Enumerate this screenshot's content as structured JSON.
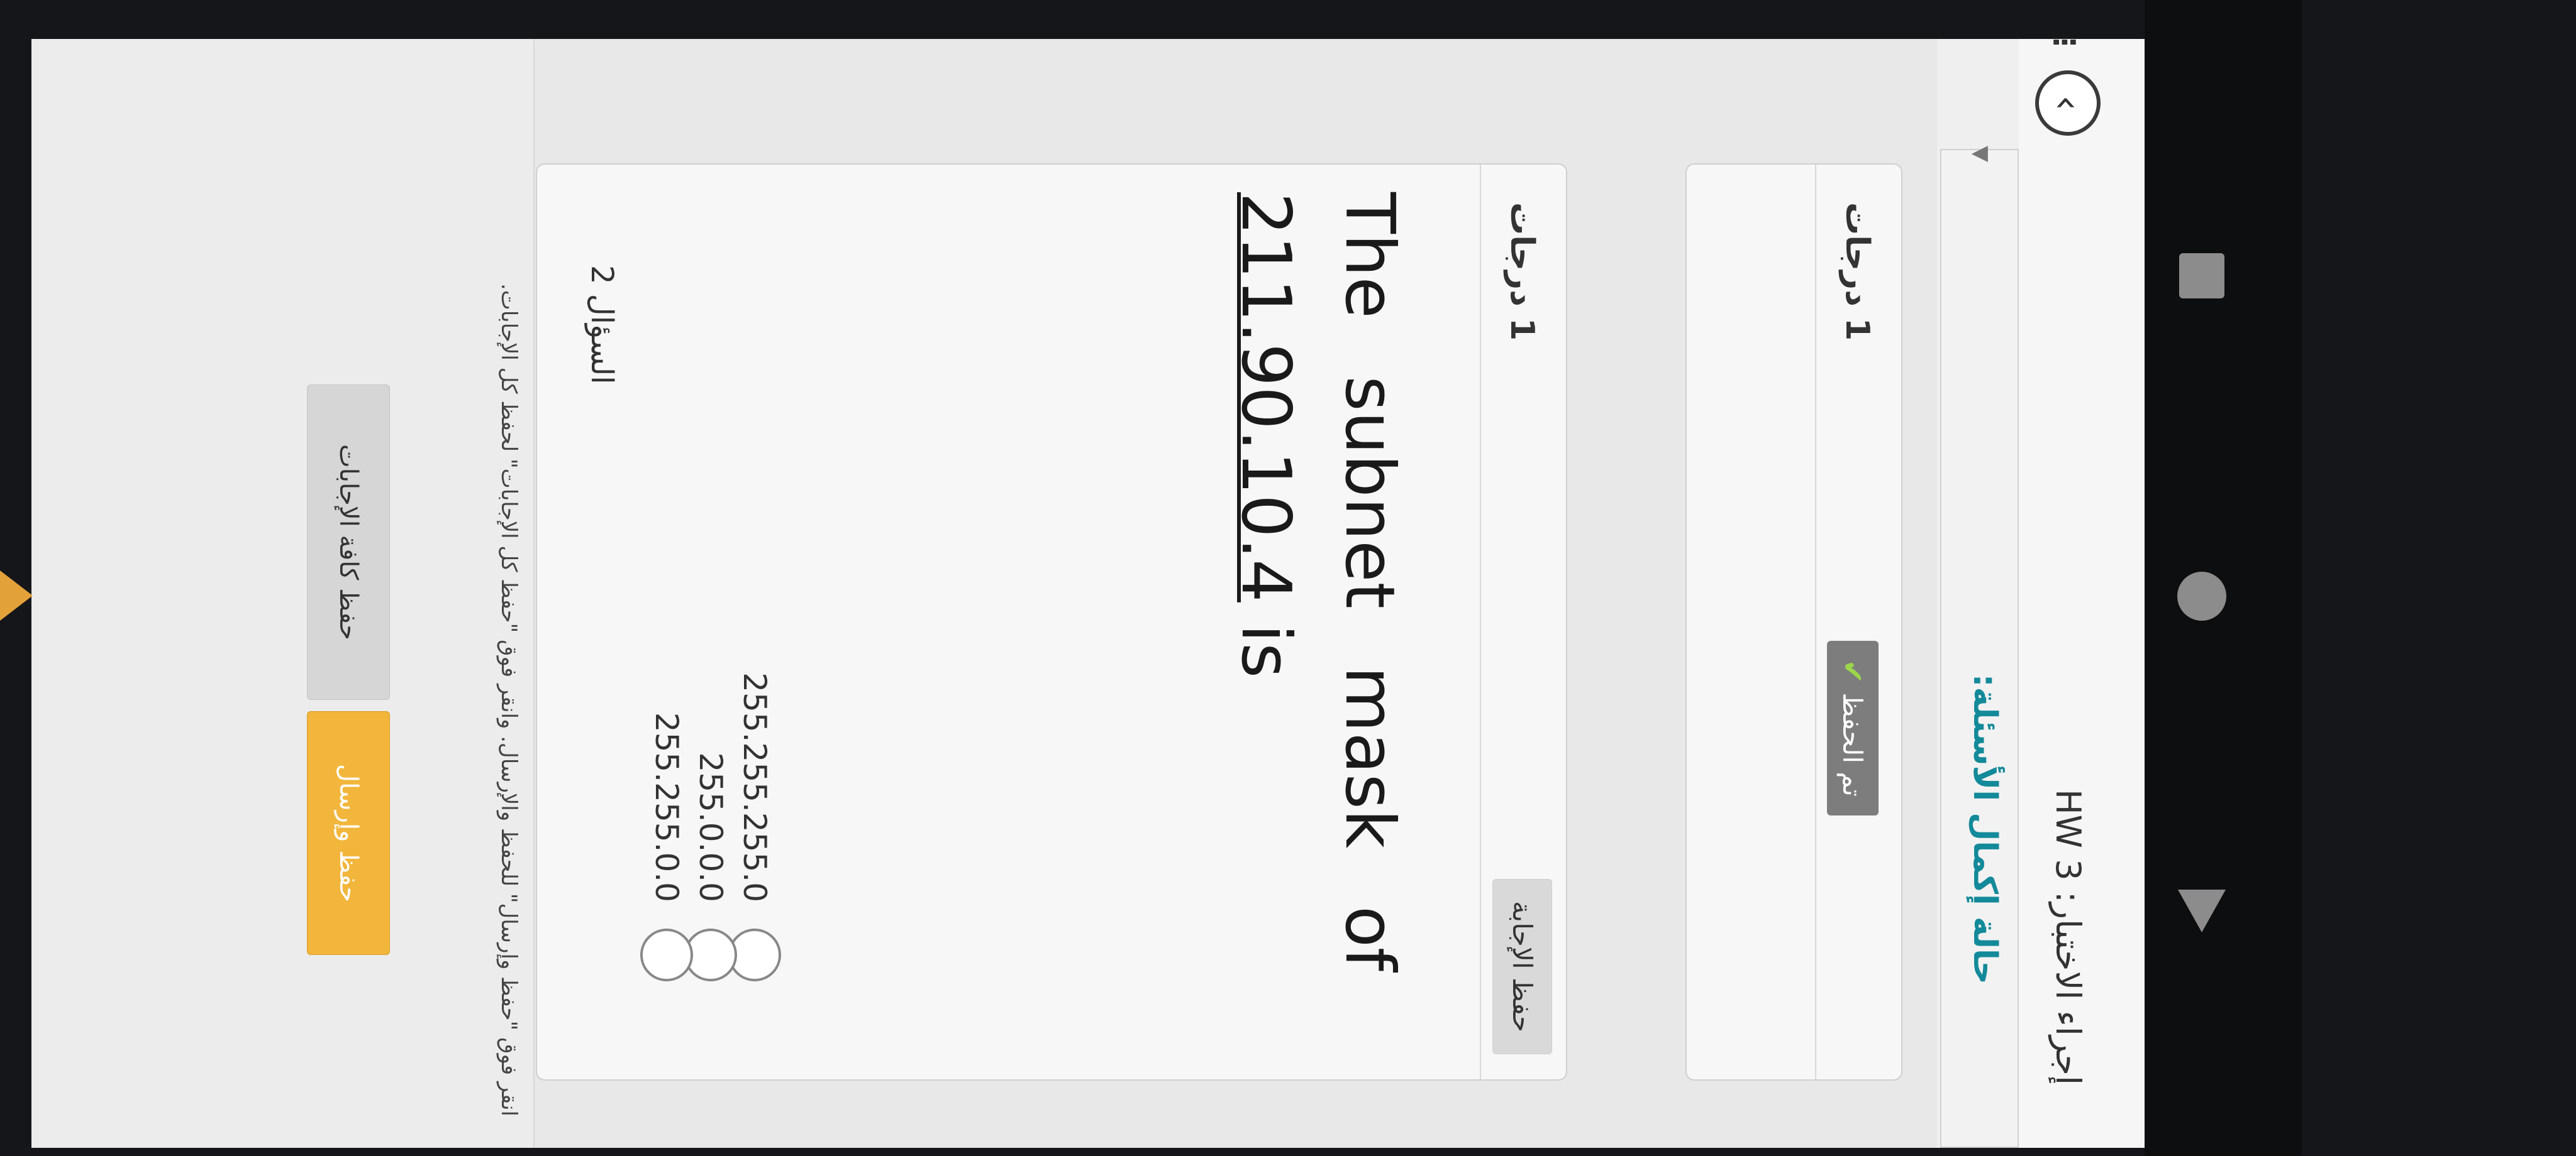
{
  "header": {
    "test_title": "إجراء الاختبار: HW 3",
    "back_icon": "chevron-left-icon",
    "menu_icon": "kebab-icon"
  },
  "status": {
    "label": "حالة إكمال الأسئلة:"
  },
  "question1": {
    "points": "1 درجات",
    "saved_label": "تم الحفظ"
  },
  "question2": {
    "number_label": "السؤال 2",
    "points": "1 درجات",
    "save_answer_label": "حفظ الإجابة",
    "text_line1": [
      "The",
      "subnet",
      "mask",
      "of"
    ],
    "text_ip": "211.90.10.4",
    "text_end": " is",
    "choices": [
      "255.255.255.0",
      "255.0.0.0",
      "255.255.0.0"
    ]
  },
  "footer": {
    "instruction": "انقر فوق \"حفظ وإرسال\" للحفظ والإرسال. وانقر فوق \"حفظ كل الإجابات\" لحفظ كل الإجابات.",
    "save_all_label": "حفظ كافة الإجابات",
    "submit_label": "حفظ وإرسال"
  },
  "colors": {
    "accent_teal": "#138a9a",
    "submit_yellow": "#f2b63c",
    "saved_gray": "#7d7d7d",
    "check_green": "#9cd64a"
  }
}
